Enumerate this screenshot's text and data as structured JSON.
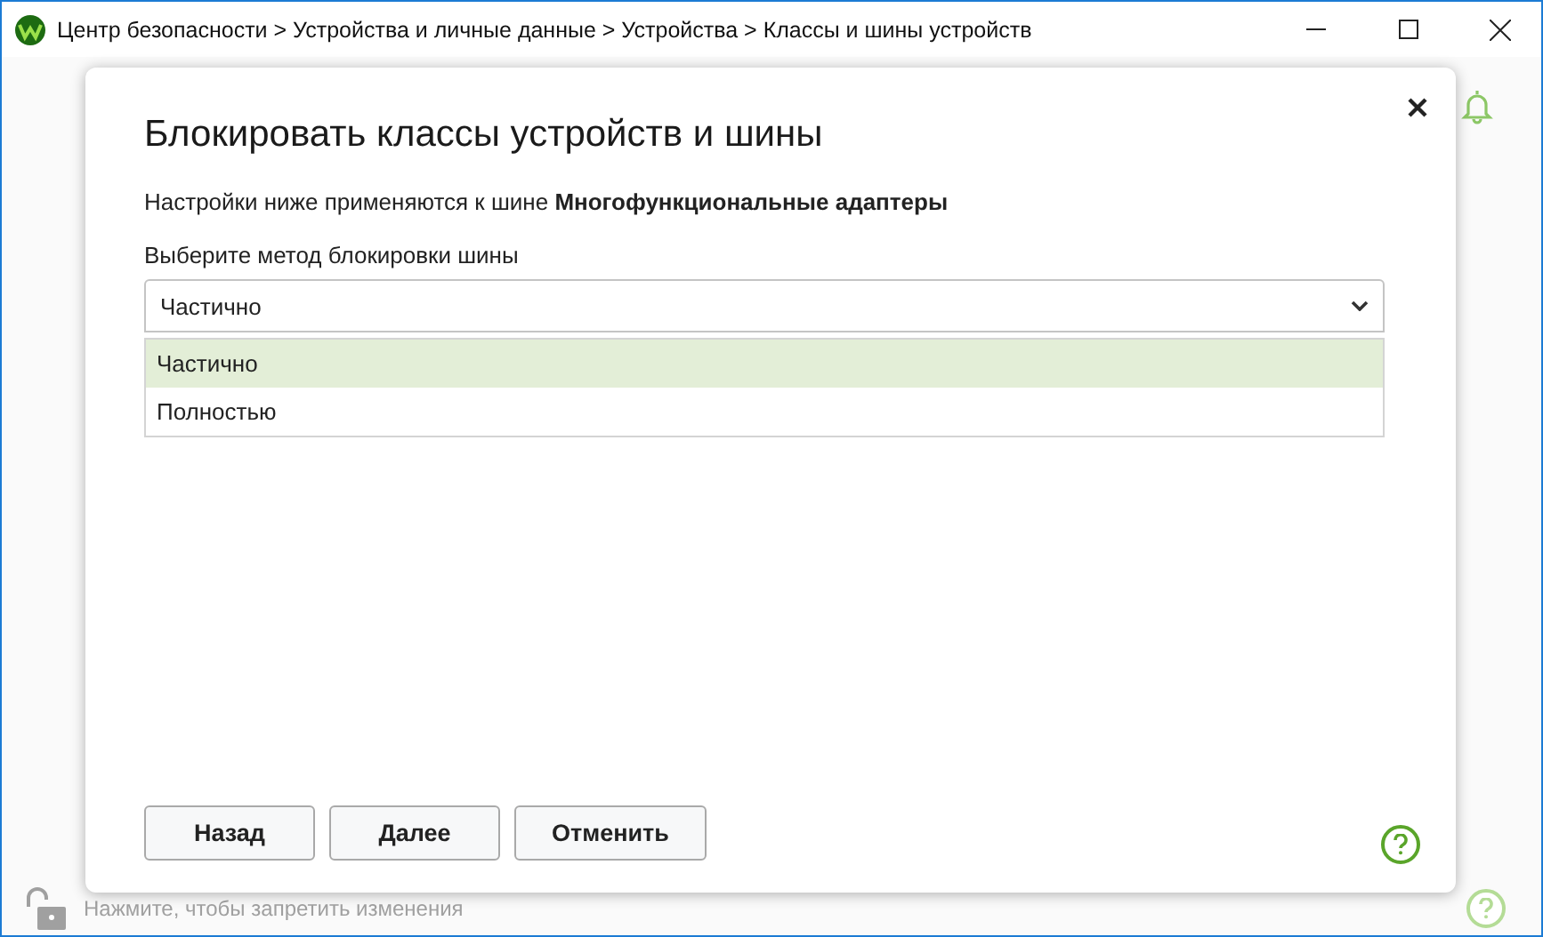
{
  "window": {
    "title": "Центр безопасности > Устройства и личные данные > Устройства > Классы и шины устройств"
  },
  "dialog": {
    "title": "Блокировать классы устройств и шины",
    "description": "Настройки ниже применяются к шине **Многофункциональные адаптеры**",
    "field_label": "Выберите метод блокировки шины",
    "select": {
      "value": "Частично",
      "expanded": true
    },
    "options": [
      {
        "label": "Частично",
        "selected": true
      },
      {
        "label": "Полностью",
        "selected": false
      }
    ],
    "buttons": [
      "Назад",
      "Далее",
      "Отменить"
    ]
  },
  "status_bar": {
    "text": "Нажмите, чтобы запретить изменения"
  }
}
